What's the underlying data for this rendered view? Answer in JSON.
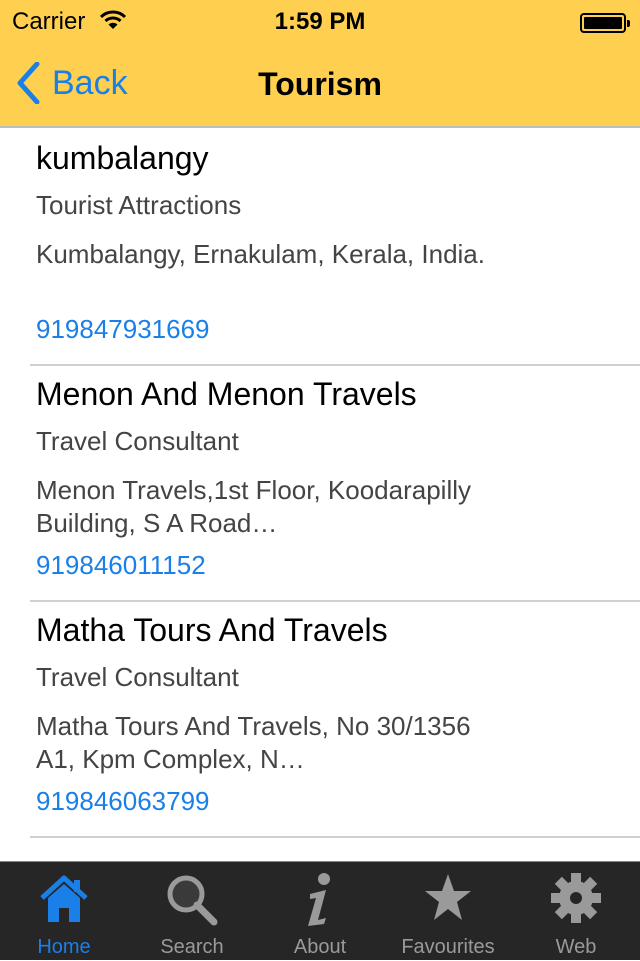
{
  "status_bar": {
    "carrier": "Carrier",
    "time": "1:59 PM",
    "wifi_icon": "wifi-icon",
    "battery_level": 1.0
  },
  "nav": {
    "back_label": "Back",
    "title": "Tourism"
  },
  "listings": [
    {
      "name": "kumbalangy",
      "category": "Tourist Attractions",
      "address": "Kumbalangy, Ernakulam, Kerala, India.",
      "phone": "919847931669"
    },
    {
      "name": "Menon And Menon Travels",
      "category": "Travel Consultant",
      "address": "Menon Travels,1st Floor, Koodarapilly Building, S A Road…",
      "phone": "919846011152"
    },
    {
      "name": "Matha Tours And Travels",
      "category": "Travel Consultant",
      "address": "Matha Tours And Travels, No 30/1356 A1, Kpm Complex, N…",
      "phone": "919846063799"
    }
  ],
  "tabs": [
    {
      "label": "Home",
      "icon": "home-icon",
      "active": true
    },
    {
      "label": "Search",
      "icon": "search-icon",
      "active": false
    },
    {
      "label": "About",
      "icon": "info-icon",
      "active": false
    },
    {
      "label": "Favourites",
      "icon": "star-icon",
      "active": false
    },
    {
      "label": "Web",
      "icon": "gear-icon",
      "active": false
    }
  ],
  "colors": {
    "header_bg": "#ffd04f",
    "accent": "#1a7fe6",
    "tabbar_bg": "#262626",
    "tab_inactive": "#9a9a9a"
  }
}
